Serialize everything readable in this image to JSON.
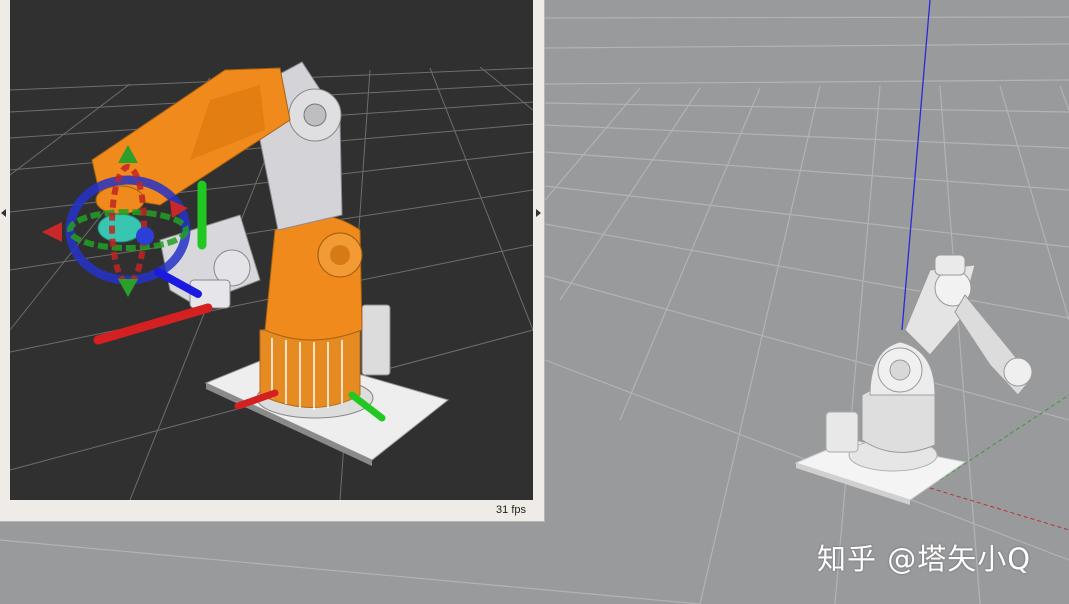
{
  "rviz": {
    "fps_label": "31 fps",
    "background_color": "#303030",
    "robot_highlight_color": "#f08a1c",
    "robot_body_color": "#d8d8dc"
  },
  "gazebo": {
    "background_color": "#999a9c",
    "robot_color": "#ececec"
  },
  "watermark": {
    "text": "知乎 @塔矢小Q"
  },
  "icons": {
    "splitter_left": "triangle-left-icon",
    "splitter_right": "triangle-right-icon"
  }
}
